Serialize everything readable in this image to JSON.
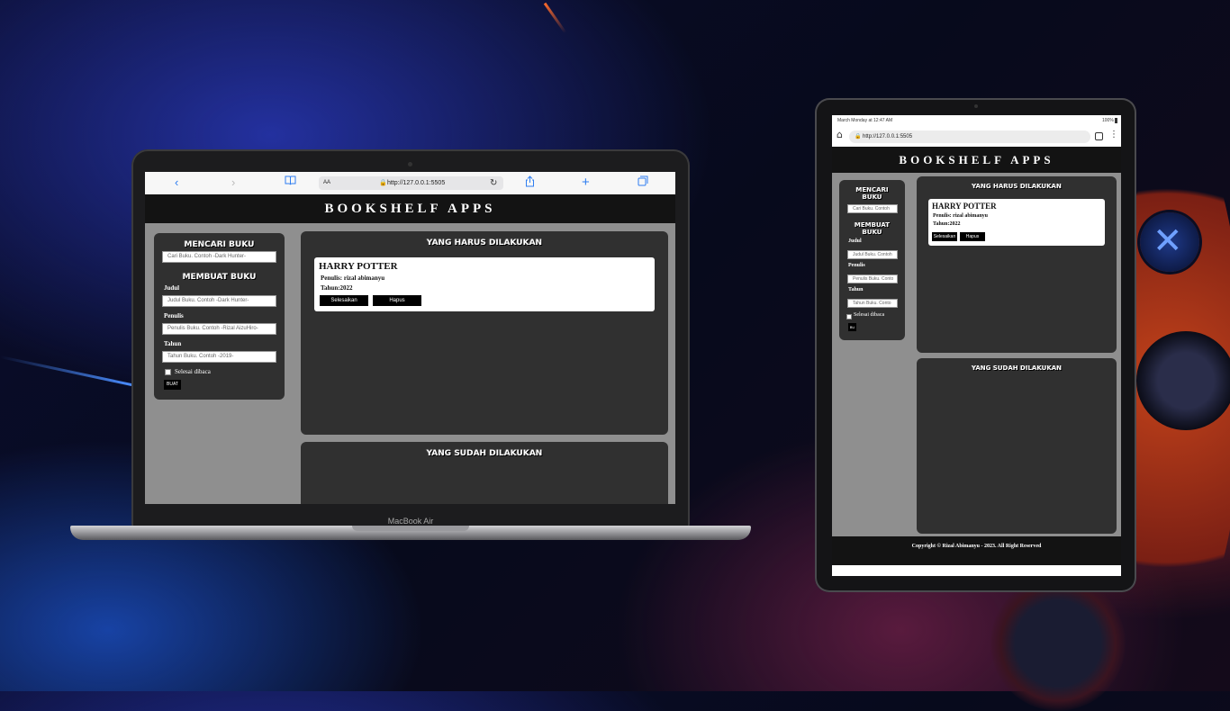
{
  "desktop": {
    "browser": {
      "url": "http://127.0.0.1:5505",
      "text_size_label": "AA",
      "back_icon": "chevron-left",
      "forward_icon": "chevron-right",
      "bookmarks_icon": "book",
      "reload_icon": "reload",
      "share_icon": "share",
      "new_tab_icon": "plus",
      "tabs_icon": "tabs",
      "accent_color": "#2f7ef0"
    },
    "device_label": "MacBook Air",
    "app": {
      "title": "BOOKSHELF APPS",
      "search": {
        "heading": "MENCARI BUKU",
        "placeholder": "Cari Buku. Contoh -Dark Hunter-"
      },
      "form": {
        "heading": "MEMBUAT BUKU",
        "title_label": "Judul",
        "title_placeholder": "Judul Buku. Contoh -Dark Hunter-",
        "author_label": "Penulis",
        "author_placeholder": "Penulis Buku. Contoh -Rizal AizuHiro-",
        "year_label": "Tahun",
        "year_placeholder": "Tahun Buku. Contoh -2019-",
        "checkbox_label": "Selesai dibaca",
        "submit_label": "BUAT"
      },
      "unfinished_heading": "YANG HARUS DILAKUKAN",
      "finished_heading": "YANG SUDAH DILAKUKAN",
      "books": [
        {
          "title": "HARRY POTTER",
          "author_line": "Penulis: rizal abimanyu",
          "year_line": "Tahun:2022",
          "finish_label": "Selesaikan",
          "delete_label": "Hapus"
        }
      ]
    }
  },
  "tablet": {
    "status_bar": {
      "time_text": "March Monday at 12:47 AM",
      "battery_text": "100%"
    },
    "url": "http://127.0.0.1:5505",
    "home_icon": "home",
    "tabs_icon": "tab-count",
    "menu_icon": "kebab-menu",
    "app": {
      "title": "BOOKSHELF APPS",
      "search": {
        "heading_line1": "MENCARI",
        "heading_line2": "BUKU",
        "placeholder": "Cari Buku. Contoh"
      },
      "form": {
        "heading_line1": "MEMBUAT",
        "heading_line2": "BUKU",
        "title_label": "Judul",
        "title_placeholder": "Judul Buku. Contoh",
        "author_label": "Penulis",
        "author_placeholder": "Penulis Buku. Conto",
        "year_label": "Tahun",
        "year_placeholder": "Tahun Buku. Conto",
        "checkbox_label": "Selesai dibaca",
        "submit_label": "BU"
      },
      "unfinished_heading": "YANG HARUS DILAKUKAN",
      "finished_heading": "YANG SUDAH DILAKUKAN",
      "books": [
        {
          "title": "HARRY POTTER",
          "author_line": "Penulis: rizal abimanyu",
          "year_line": "Tahun:2022",
          "finish_label": "Selesaikan",
          "delete_label": "Hapus"
        }
      ],
      "footer": "Copyright © Rizal Abimanyu - 2023. All Right Reserved"
    }
  }
}
